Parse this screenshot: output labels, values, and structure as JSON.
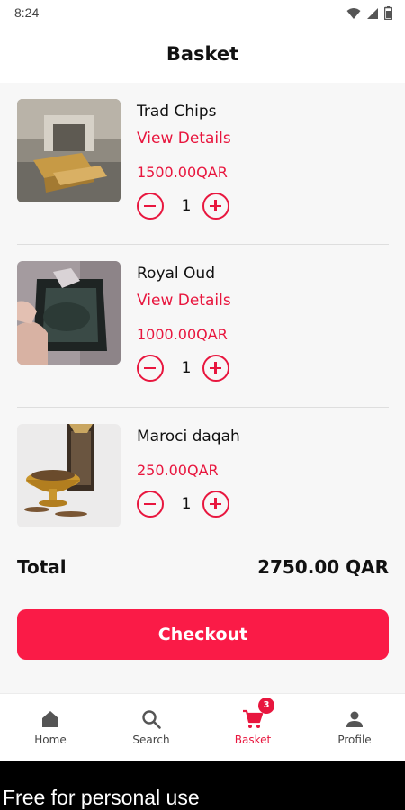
{
  "status_bar": {
    "time": "8:24",
    "icons": [
      "wifi-icon",
      "signal-icon",
      "battery-icon"
    ]
  },
  "header": {
    "title": "Basket"
  },
  "basket": {
    "items": [
      {
        "name": "Trad Chips",
        "details_link": "View Details",
        "price": "1500.00QAR",
        "quantity": "1",
        "image": "trad-chips-photo"
      },
      {
        "name": "Royal Oud",
        "details_link": "View Details",
        "price": "1000.00QAR",
        "quantity": "1",
        "image": "royal-oud-photo"
      },
      {
        "name": "Maroci daqah",
        "price": "250.00QAR",
        "quantity": "1",
        "image": "maroci-daqah-photo"
      }
    ],
    "total_label": "Total",
    "total_value": "2750.00 QAR",
    "checkout_label": "Checkout"
  },
  "bottom_nav": {
    "items": [
      {
        "label": "Home",
        "icon": "home-icon",
        "active": false
      },
      {
        "label": "Search",
        "icon": "search-icon",
        "active": false
      },
      {
        "label": "Basket",
        "icon": "cart-icon",
        "active": true,
        "badge": "3"
      },
      {
        "label": "Profile",
        "icon": "person-icon",
        "active": false
      }
    ]
  },
  "footer": {
    "text": "Free for personal use"
  },
  "colors": {
    "accent": "#e8163e",
    "checkout": "#fa1b47",
    "background": "#f7f7f7"
  }
}
